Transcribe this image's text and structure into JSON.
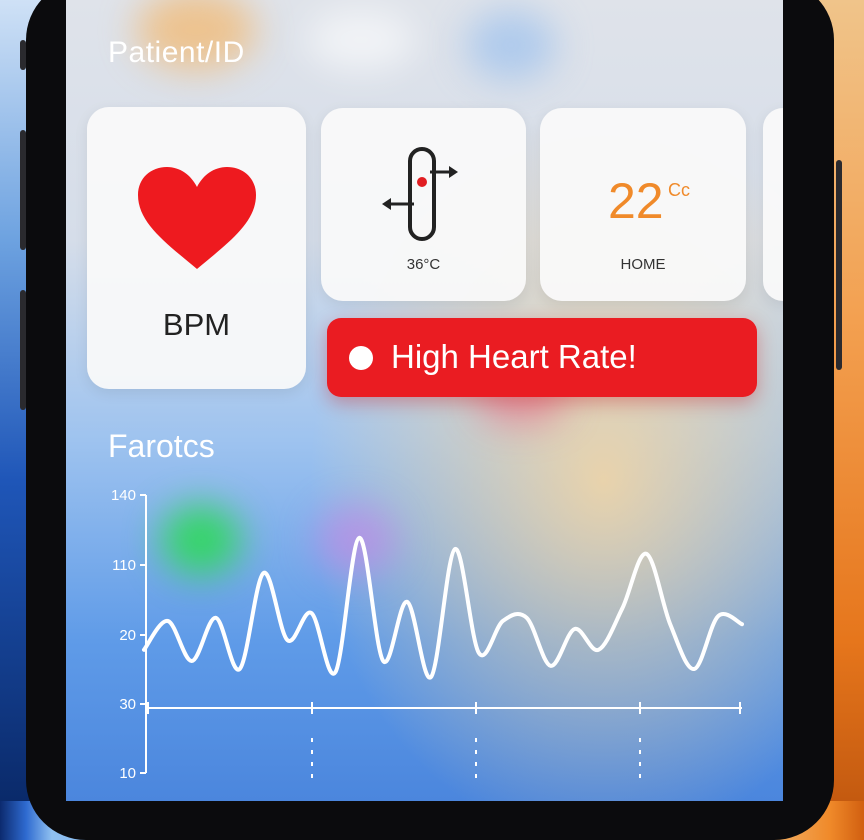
{
  "header": {
    "title": "Patient/ID"
  },
  "cards": {
    "bpm": {
      "label": "BPM",
      "icon": "heart-icon"
    },
    "temperature": {
      "label": "36°C",
      "icon": "thermometer-icon"
    },
    "home": {
      "value": "22",
      "unit": "Cc",
      "label": "HOME"
    }
  },
  "alert": {
    "text": "High Heart Rate!"
  },
  "section": {
    "title": "Farotcs"
  },
  "chart_data": {
    "type": "line",
    "title": "",
    "xlabel": "",
    "ylabel": "",
    "y_tick_labels": [
      "140",
      "110",
      "20",
      "30",
      "10"
    ],
    "grid": false,
    "series": [
      {
        "values": [
          42,
          60,
          35,
          62,
          30,
          90,
          48,
          65,
          28,
          112,
          35,
          72,
          25,
          105,
          40,
          60,
          62,
          32,
          55,
          42,
          68,
          102,
          58,
          30,
          63,
          58
        ]
      }
    ]
  },
  "colors": {
    "alert": "#ea1c22",
    "heart": "#ee1a1f",
    "home_temp": "#f08a2a"
  }
}
